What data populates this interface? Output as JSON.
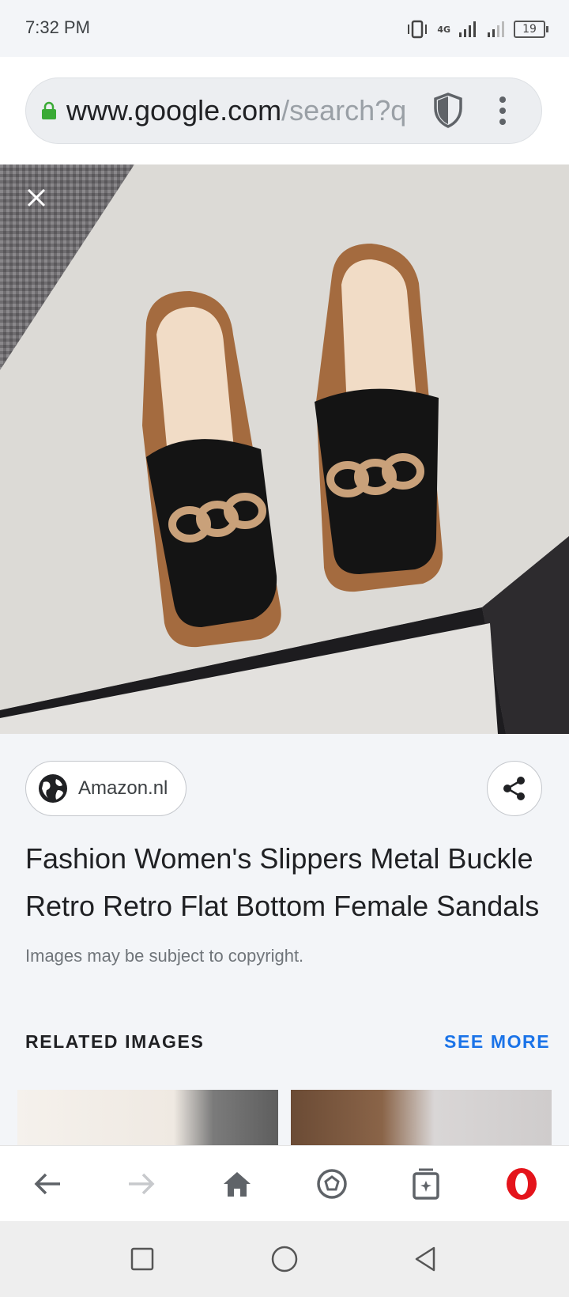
{
  "status_bar": {
    "time": "7:32 PM",
    "network": "4G",
    "battery": "19"
  },
  "browser": {
    "url_host": "www.google.com",
    "url_path": "/search?q",
    "icons": [
      "lock-icon",
      "shield-icon",
      "more-vert-icon"
    ]
  },
  "viewer": {
    "image_description_icon": "close-icon"
  },
  "details": {
    "source": "Amazon.nl",
    "title": "Fashion Women's Slippers Metal Buckle Retro Retro Flat Bottom Female Sandals",
    "copyright": "Images may be subject to copyright."
  },
  "related": {
    "heading": "RELATED IMAGES",
    "see_more": "SEE MORE"
  },
  "bottom_nav": [
    "back-icon",
    "forward-icon",
    "home-icon",
    "speed-dial-icon",
    "tabs-icon",
    "opera-menu-icon"
  ],
  "colors": {
    "accent": "#1a73e8",
    "opera_red": "#e4141b",
    "lock_green": "#3aaa35",
    "background": "#f3f5f8"
  }
}
